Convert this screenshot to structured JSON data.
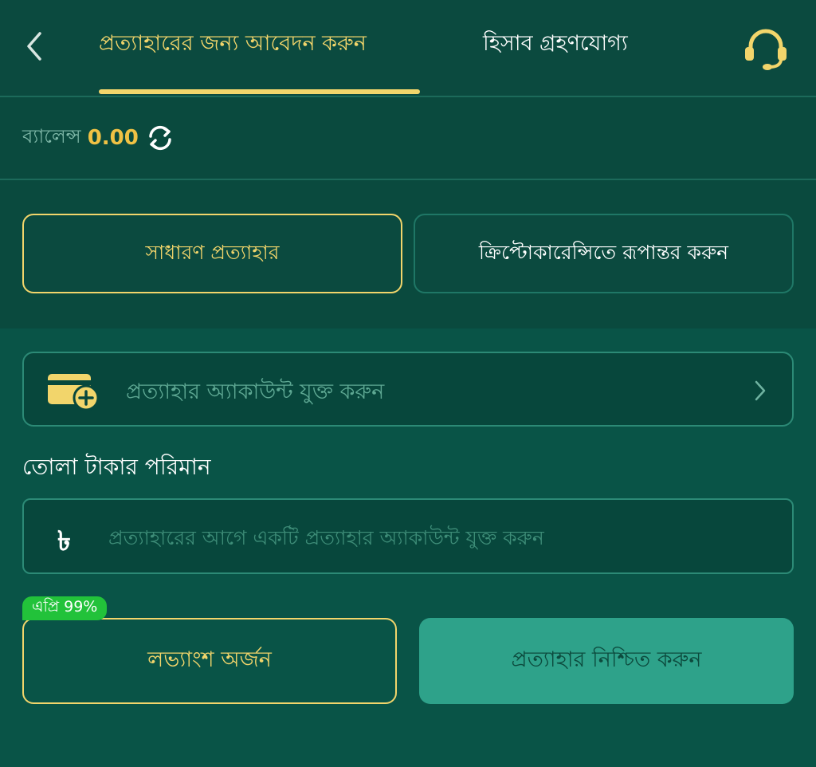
{
  "header": {
    "tabs": [
      {
        "label": "প্রত্যাহারের জন্য আবেদন করুন",
        "active": true
      },
      {
        "label": "হিসাব গ্রহণযোগ্য",
        "active": false
      }
    ],
    "back_icon": "chevron-left-icon",
    "support_icon": "headset-icon"
  },
  "balance": {
    "label": "ব্যালেন্স",
    "value": "0.00",
    "refresh_icon": "refresh-icon"
  },
  "withdraw_modes": {
    "normal": "সাধারণ প্রত্যাহার",
    "crypto": "ক্রিপ্টোকারেন্সিতে রূপান্তর করুন",
    "selected": "normal"
  },
  "add_account": {
    "label": "প্রত্যাহার অ্যাকাউন্ট যুক্ত করুন",
    "icon": "wallet-add-icon"
  },
  "amount": {
    "title": "তোলা টাকার পরিমান",
    "currency_symbol": "৳",
    "placeholder": "প্রত্যাহারের আগে একটি প্রত্যাহার অ্যাকাউন্ট যুক্ত করুন",
    "value": ""
  },
  "actions": {
    "apr_badge": "এপ্রি 99%",
    "earn_label": "লভ্যাংশ অর্জন",
    "confirm_label": "প্রত্যাহার নিশ্চিত করুন"
  },
  "colors": {
    "background": "#0a4a3e",
    "accent_gold": "#f2d56b",
    "balance_value": "#f0c244",
    "confirm_button": "#2ea28a",
    "badge_green": "#22c23a"
  }
}
